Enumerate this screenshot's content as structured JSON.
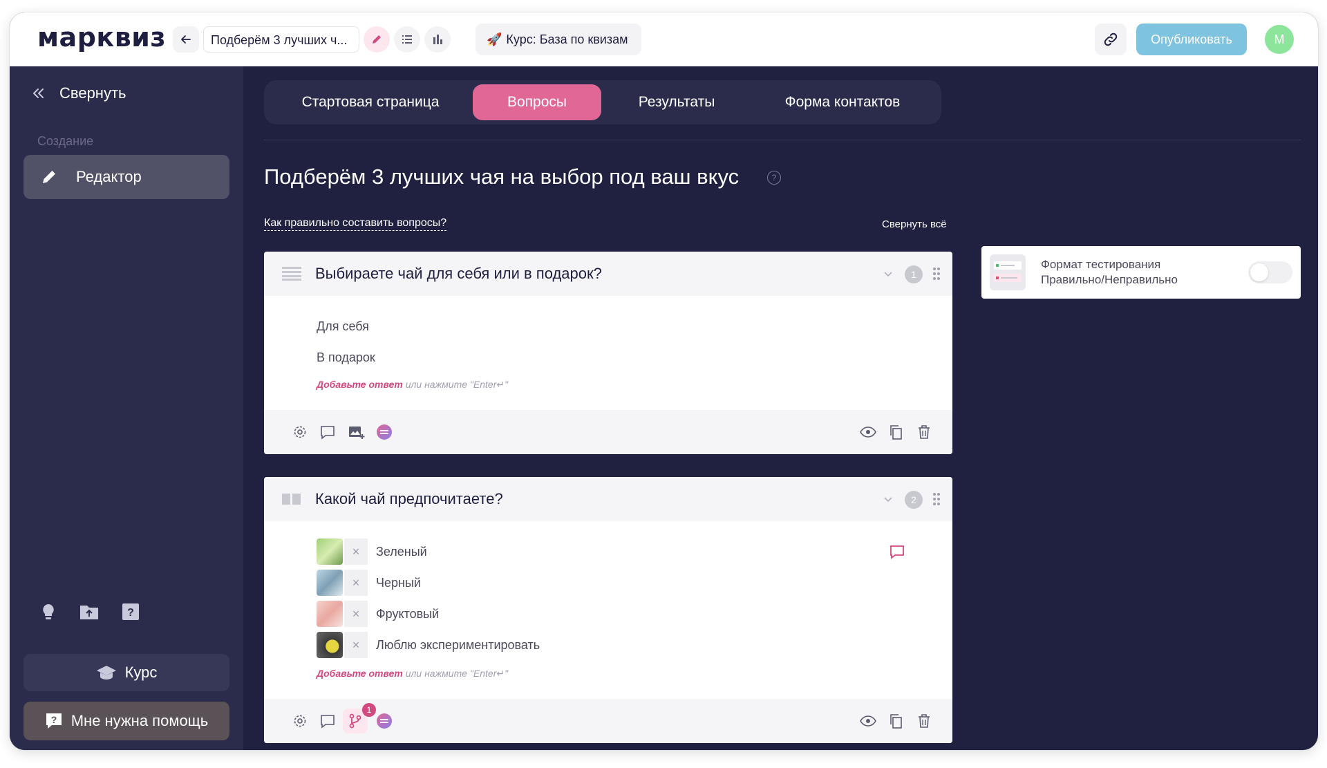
{
  "header": {
    "logo": "марквиз",
    "quiz_title": "Подберём 3 лучших ч...",
    "course_label": "Курс: База по квизам",
    "publish_label": "Опубликовать",
    "avatar_letter": "М"
  },
  "sidebar": {
    "collapse_label": "Свернуть",
    "section_label": "Создание",
    "editor_label": "Редактор",
    "course_label": "Курс",
    "help_label": "Мне нужна помощь"
  },
  "tabs": [
    "Стартовая страница",
    "Вопросы",
    "Результаты",
    "Форма контактов"
  ],
  "main": {
    "page_title": "Подберём 3 лучших чая на выбор под ваш вкус",
    "howto_link": "Как правильно составить вопросы?",
    "collapse_all": "Свернуть всё"
  },
  "questions": [
    {
      "title": "Выбираете чай для себя или в подарок?",
      "number": "1",
      "answers": [
        "Для себя",
        "В подарок"
      ],
      "add_answer": "Добавьте ответ",
      "add_hint": "или нажмите \"Enter↵\""
    },
    {
      "title": "Какой чай предпочитаете?",
      "number": "2",
      "answers": [
        "Зеленый",
        "Черный",
        "Фруктовый",
        "Люблю экспериментировать"
      ],
      "add_answer": "Добавьте ответ",
      "add_hint": "или нажмите \"Enter↵\"",
      "branch_badge": "1"
    }
  ],
  "side_card": {
    "line1": "Формат тестирования",
    "line2": "Правильно/Неправильно",
    "toggle_on": false
  },
  "colors": {
    "accent": "#e06796",
    "dark_bg": "#202040",
    "sidebar_bg": "#2b2b4b",
    "publish": "#7ec3df"
  }
}
